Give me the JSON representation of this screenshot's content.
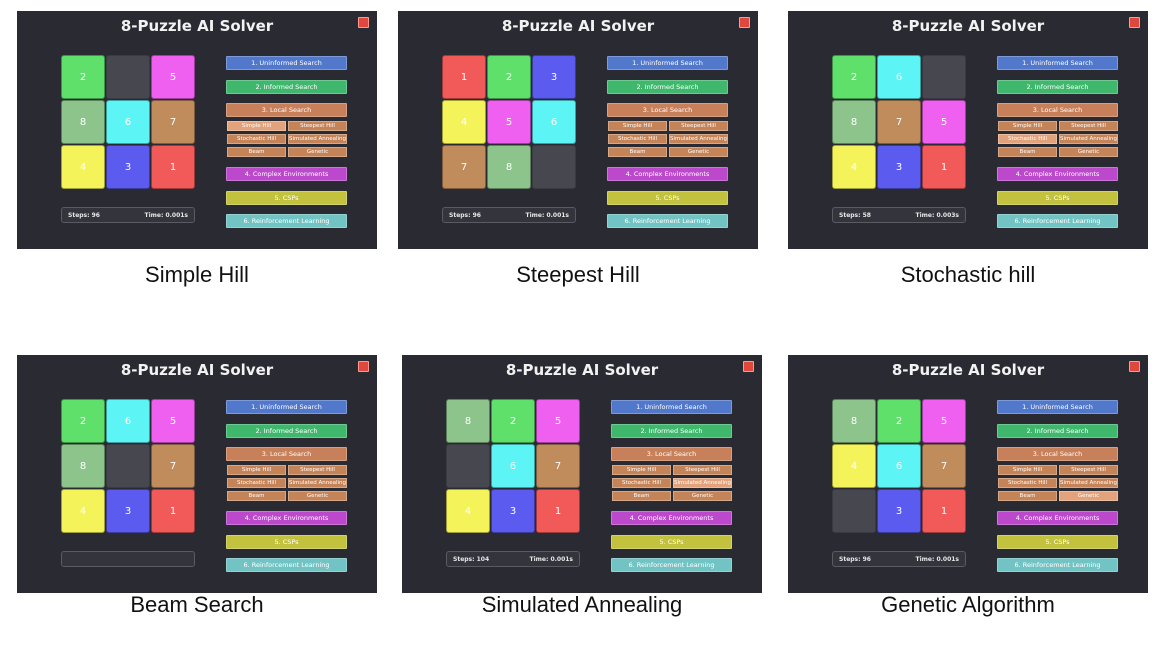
{
  "app_title": "8-Puzzle AI Solver",
  "buttons": {
    "uninformed": "1. Uninformed Search",
    "informed": "2. Informed Search",
    "local": "3. Local Search",
    "complex": "4. Complex Environments",
    "csps": "5. CSPs",
    "rl": "6. Reinforcement Learning"
  },
  "sub_buttons": [
    "Simple Hill",
    "Steepest Hill",
    "Stochastic Hill",
    "Simulated Annealing",
    "Beam",
    "Genetic"
  ],
  "labels": {
    "steps": "Steps:",
    "time": "Time:"
  },
  "colors": {
    "1": "#f25a5a",
    "2": "#5fe06a",
    "3": "#5b5bf0",
    "4": "#f4f45a",
    "5": "#f060f0",
    "6": "#5cf4f4",
    "7": "#c08c5c",
    "8": "#8cc48c",
    "uninformed": "#5278cc",
    "informed": "#3fb86e",
    "local": "#c8805a",
    "complex": "#bc48cc",
    "csps": "#c2c23e",
    "rl": "#72c4c4"
  },
  "panels": [
    {
      "caption": "Simple Hill",
      "board": [
        2,
        0,
        5,
        8,
        6,
        7,
        4,
        3,
        1
      ],
      "steps": "96",
      "time": "0.001s",
      "active_sub": 0
    },
    {
      "caption": "Steepest Hill",
      "board": [
        1,
        2,
        3,
        4,
        5,
        6,
        7,
        8,
        0
      ],
      "steps": "96",
      "time": "0.001s",
      "active_sub": -1
    },
    {
      "caption": "Stochastic hill",
      "board": [
        2,
        6,
        0,
        8,
        7,
        5,
        4,
        3,
        1
      ],
      "steps": "58",
      "time": "0.003s",
      "active_sub": 2
    },
    {
      "caption": "Beam Search",
      "board": [
        2,
        6,
        5,
        8,
        0,
        7,
        4,
        3,
        1
      ],
      "steps": "",
      "time": "",
      "active_sub": -1
    },
    {
      "caption": "Simulated Annealing",
      "board": [
        8,
        2,
        5,
        0,
        6,
        7,
        4,
        3,
        1
      ],
      "steps": "104",
      "time": "0.001s",
      "active_sub": 3
    },
    {
      "caption": "Genetic Algorithm",
      "board": [
        8,
        2,
        5,
        4,
        6,
        7,
        0,
        3,
        1
      ],
      "steps": "96",
      "time": "0.001s",
      "active_sub": 5
    }
  ]
}
